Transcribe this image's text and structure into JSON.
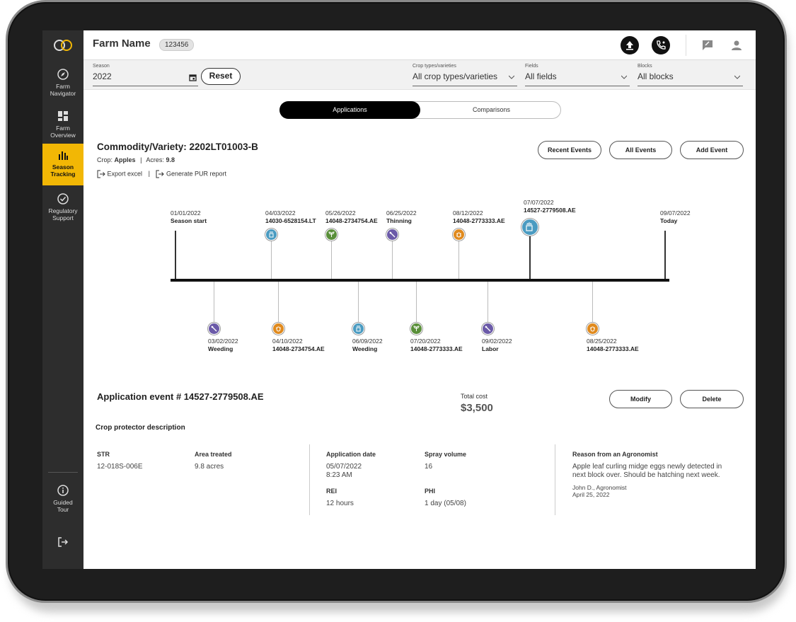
{
  "header": {
    "farm_name": "Farm Name",
    "farm_id": "123456"
  },
  "sidebar": {
    "items": [
      {
        "label1": "Farm",
        "label2": "Navigator"
      },
      {
        "label1": "Farm",
        "label2": "Overview"
      },
      {
        "label1": "Season",
        "label2": "Tracking"
      },
      {
        "label1": "Regulatory",
        "label2": "Support"
      },
      {
        "label1": "Guided",
        "label2": "Tour"
      }
    ]
  },
  "filters": {
    "season": {
      "label": "Season",
      "value": "2022"
    },
    "reset_label": "Reset",
    "crop": {
      "label": "Crop types/varieties",
      "value": "All crop types/varieties"
    },
    "fields": {
      "label": "Fields",
      "value": "All fields"
    },
    "blocks": {
      "label": "Blocks",
      "value": "All blocks"
    }
  },
  "tabs": {
    "applications": "Applications",
    "comparisons": "Comparisons"
  },
  "commodity": {
    "title": "Commodity/Variety: 2202LT01003-B",
    "crop_label": "Crop:",
    "crop_value": "Apples",
    "acres_label": "Acres:",
    "acres_value": "9.8",
    "export_excel": "Export excel",
    "generate_pur": "Generate PUR report",
    "recent_events": "Recent Events",
    "all_events": "All Events",
    "add_event": "Add Event"
  },
  "timeline": {
    "top": [
      {
        "date": "01/01/2022",
        "name": "Season start"
      },
      {
        "date": "04/03/2022",
        "name": "14030-6528154.LT"
      },
      {
        "date": "05/26/2022",
        "name": "14048-2734754.AE"
      },
      {
        "date": "06/25/2022",
        "name": "Thinning"
      },
      {
        "date": "08/12/2022",
        "name": "14048-2773333.AE"
      },
      {
        "date": "07/07/2022",
        "name": "14527-2779508.AE"
      },
      {
        "date": "09/07/2022",
        "name": "Today"
      }
    ],
    "bottom": [
      {
        "date": "03/02/2022",
        "name": "Weeding"
      },
      {
        "date": "04/10/2022",
        "name": "14048-2734754.AE"
      },
      {
        "date": "06/09/2022",
        "name": "Weeding"
      },
      {
        "date": "07/20/2022",
        "name": "14048-2773333.AE"
      },
      {
        "date": "09/02/2022",
        "name": "Labor"
      },
      {
        "date": "08/25/2022",
        "name": "14048-2773333.AE"
      }
    ]
  },
  "colors": {
    "accent": "#f2b705",
    "blue": "#4a9bc1",
    "green": "#5a8f3a",
    "purple": "#6b5aa8",
    "orange": "#e08a1e"
  },
  "detail": {
    "title": "Application event # 14527-2779508.AE",
    "total_cost_label": "Total cost",
    "total_cost": "$3,500",
    "modify": "Modify",
    "delete": "Delete",
    "crop_protector": "Crop protector description",
    "str_label": "STR",
    "str_value": "12-018S-006E",
    "area_label": "Area treated",
    "area_value": "9.8 acres",
    "app_date_label": "Application date",
    "app_date": "05/07/2022",
    "app_time": "8:23 AM",
    "spray_label": "Spray volume",
    "spray_value": "16",
    "rei_label": "REI",
    "rei_value": "12 hours",
    "phi_label": "PHI",
    "phi_value": "1 day (05/08)",
    "reason_label": "Reason from an Agronomist",
    "reason_line1": "Apple leaf curling midge eggs newly detected in",
    "reason_line2": "next block over. Should be hatching next week.",
    "author": "John D., Agronomist",
    "author_date": "April 25, 2022"
  }
}
